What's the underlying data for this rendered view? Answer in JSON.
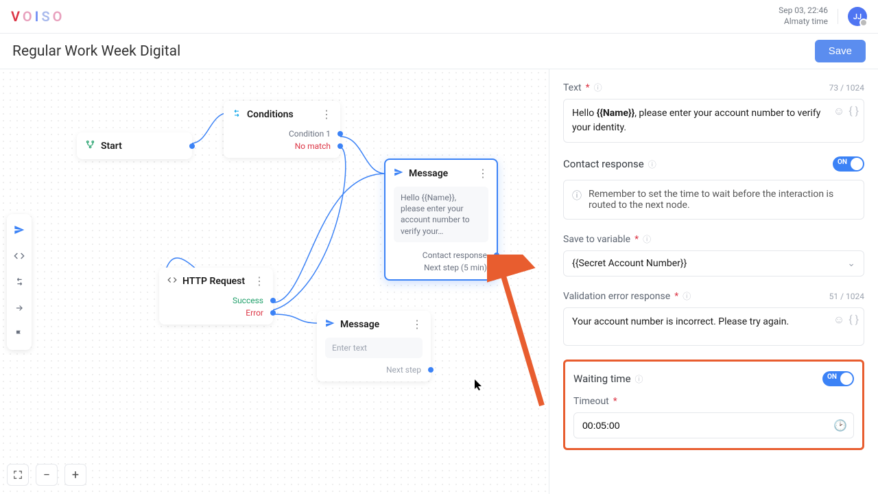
{
  "header": {
    "logo": "VOISO",
    "date": "Sep 03, 22:46",
    "tz": "Almaty time",
    "avatar": "JJ"
  },
  "page": {
    "title": "Regular Work Week Digital",
    "save": "Save"
  },
  "canvas": {
    "start": {
      "label": "Start"
    },
    "conditions": {
      "label": "Conditions",
      "out1": "Condition 1",
      "out2": "No match"
    },
    "http": {
      "label": "HTTP Request",
      "out1": "Success",
      "out2": "Error"
    },
    "message1": {
      "label": "Message",
      "body": "Hello {{Name}}, please enter your account number to verify your…",
      "out1": "Contact response",
      "out2": "Next step (5 min)"
    },
    "message2": {
      "label": "Message",
      "placeholder": "Enter text",
      "out1": "Next step"
    }
  },
  "panel": {
    "text": {
      "label": "Text",
      "counter": "73 / 1024",
      "value_pre": "Hello ",
      "value_bold": "{{Name}}",
      "value_post": ", please enter your account number to verify your identity."
    },
    "contact_response": {
      "label": "Contact response",
      "toggle": "ON"
    },
    "callout": "Remember to set the time to wait before the interaction is routed to the next node.",
    "save_var": {
      "label": "Save to variable",
      "value": "{{Secret Account Number}}"
    },
    "validation": {
      "label": "Validation error response",
      "counter": "51 / 1024",
      "value": "Your account number is incorrect. Please try again."
    },
    "waiting": {
      "label": "Waiting time",
      "toggle": "ON",
      "timeout_label": "Timeout",
      "timeout_value": "00:05:00"
    }
  }
}
